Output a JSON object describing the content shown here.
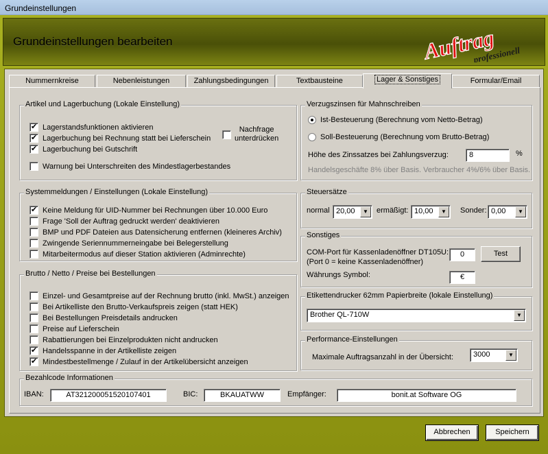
{
  "window": {
    "title": "Grundeinstellungen"
  },
  "header": {
    "title": "Grundeinstellungen bearbeiten",
    "logo_main": "Auftrag",
    "logo_sub": "professionell"
  },
  "tabs": [
    {
      "label": "Nummernkreise"
    },
    {
      "label": "Nebenleistungen"
    },
    {
      "label": "Zahlungsbedingungen"
    },
    {
      "label": "Textbausteine"
    },
    {
      "label": "Lager & Sonstiges",
      "active": true
    },
    {
      "label": "Formular/Email"
    }
  ],
  "artikel": {
    "title": "Artikel und Lagerbuchung (Lokale Einstellung)",
    "items": [
      {
        "label": "Lagerstandsfunktionen aktivieren",
        "checked": true
      },
      {
        "label": "Lagerbuchung bei Rechnung statt bei Lieferschein",
        "checked": true
      },
      {
        "label": "Lagerbuchung bei Gutschrift",
        "checked": true
      },
      {
        "label": "Warnung bei Unterschreiten des Mindestlagerbestandes",
        "checked": false
      }
    ],
    "nachfrage_line1": "Nachfrage",
    "nachfrage_line2": "unterdrücken",
    "nachfrage_checked": false
  },
  "system": {
    "title": "Systemmeldungen / Einstellungen  (Lokale Einstellung)",
    "items": [
      {
        "label": "Keine Meldung für UID-Nummer bei Rechnungen über 10.000 Euro",
        "checked": true
      },
      {
        "label": "Frage 'Soll der Auftrag gedruckt werden' deaktivieren",
        "checked": false
      },
      {
        "label": "BMP und PDF Dateien aus Datensicherung entfernen (kleineres Archiv)",
        "checked": false
      },
      {
        "label": "Zwingende Seriennummerneingabe bei Belegerstellung",
        "checked": false
      },
      {
        "label": "Mitarbeitermodus auf dieser Station aktivieren (Adminrechte)",
        "checked": false
      }
    ]
  },
  "brutto": {
    "title": "Brutto / Netto / Preise bei Bestellungen",
    "items": [
      {
        "label": "Einzel- und Gesamtpreise auf der Rechnung brutto (inkl. MwSt.) anzeigen",
        "checked": false
      },
      {
        "label": "Bei Artikelliste den Brutto-Verkaufspreis zeigen (statt HEK)",
        "checked": false
      },
      {
        "label": "Bei Bestellungen Preisdetails andrucken",
        "checked": false
      },
      {
        "label": "Preise auf Lieferschein",
        "checked": false
      },
      {
        "label": "Rabattierungen bei Einzelprodukten nicht andrucken",
        "checked": false
      },
      {
        "label": "Handelsspanne in der Artikelliste zeigen",
        "checked": true
      },
      {
        "label": "Mindestbestellmenge / Zulauf in der Artikelübersicht anzeigen",
        "checked": true
      }
    ]
  },
  "verzug": {
    "title": "Verzugszinsen für Mahnschreiben",
    "radio1": "Ist-Besteuerung (Berechnung vom Netto-Betrag)",
    "radio2": "Soll-Besteuerung (Berechnung vom Brutto-Betrag)",
    "selected": 1,
    "rate_label": "Höhe des Zinssatzes bei Zahlungsverzug:",
    "rate_value": "8",
    "percent": "%",
    "hint": "Handelsgeschäfte 8% über Basis. Verbraucher 4%/6% über Basis."
  },
  "steuer": {
    "title": "Steuersätze",
    "normal_label": "normal",
    "normal_value": "20,00",
    "ermaessigt_label": "ermäßigt:",
    "ermaessigt_value": "10,00",
    "sonder_label": "Sonder:",
    "sonder_value": "0,00"
  },
  "sonstiges": {
    "title": "Sonstiges",
    "com_label": "COM-Port für Kassenladenöffner DT105U:",
    "com_hint": "(Port 0 = keine Kassenladenöffner)",
    "com_value": "0",
    "test_button": "Test",
    "currency_label": "Währungs Symbol:",
    "currency_value": "€"
  },
  "etikett": {
    "title": "Etikettendrucker 62mm Papierbreite (lokale Einstellung)",
    "value": "Brother QL-710W"
  },
  "performance": {
    "title": "Performance-Einstellungen",
    "label": "Maximale Auftragsanzahl in der Übersicht:",
    "value": "3000"
  },
  "bezahl": {
    "title": "Bezahlcode Informationen",
    "iban_label": "IBAN:",
    "iban_value": "AT321200051520107401",
    "bic_label": "BIC:",
    "bic_value": "BKAUATWW",
    "empf_label": "Empfänger:",
    "empf_value": "bonit.at Software OG"
  },
  "footer": {
    "cancel": "Abbrechen",
    "save": "Speichern"
  },
  "colors": {
    "frame": "#9aa018",
    "header": "#5a600c",
    "logo_red": "#e01010"
  }
}
